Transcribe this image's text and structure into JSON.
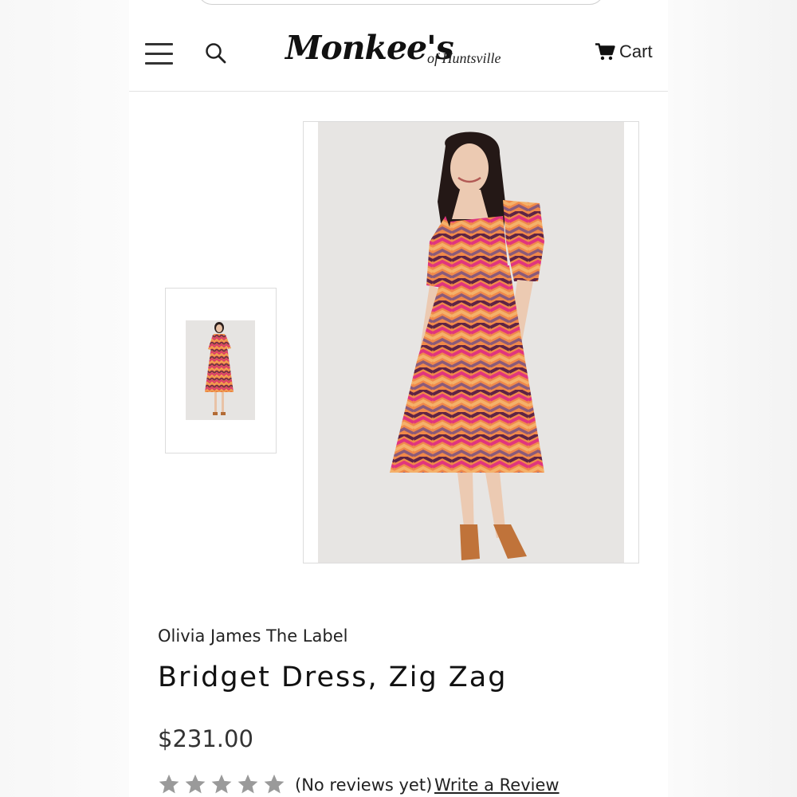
{
  "header": {
    "logo_text": "Monkee's",
    "logo_subtext": "of Huntsville",
    "cart_label": "Cart"
  },
  "product": {
    "brand": "Olivia James The Label",
    "name": "Bridget Dress, Zig Zag",
    "price": "$231.00",
    "rating_stars": 5,
    "reviews_text": "(No reviews yet)",
    "write_review_label": "Write a Review"
  },
  "colors": {
    "background": "#ffffff",
    "text": "#222222",
    "star_empty": "#9a9a9a",
    "photo_backdrop": "#e7e5e3"
  },
  "icons": [
    "hamburger-menu-icon",
    "search-icon",
    "cart-icon",
    "star-icon"
  ]
}
